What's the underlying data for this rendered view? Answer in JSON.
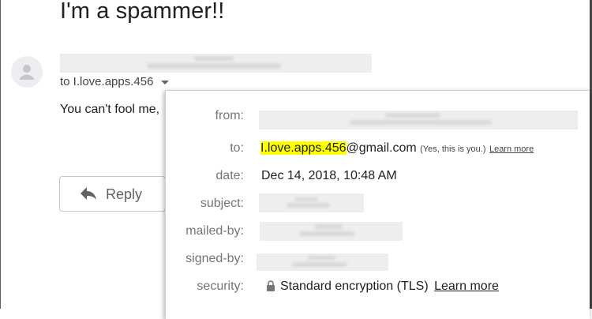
{
  "email": {
    "subject": "I'm a spammer!!",
    "to_summary": "to I.love.apps.456",
    "body_preview": "You can't fool me,",
    "reply_label": "Reply"
  },
  "details": {
    "from_label": "from:",
    "to_label": "to:",
    "to_highlight": "I.love.apps.456",
    "to_domain": "@gmail.com",
    "to_note": "(Yes, this is you.)",
    "to_learn_more": "Learn more",
    "date_label": "date:",
    "date_value": "Dec 14, 2018, 10:48 AM",
    "subject_label": "subject:",
    "mailed_by_label": "mailed-by:",
    "signed_by_label": "signed-by:",
    "security_label": "security:",
    "security_value": "Standard encryption (TLS)",
    "security_learn_more": "Learn more"
  },
  "colors": {
    "highlight": "#ffff00",
    "redaction": "#eeeeee"
  },
  "icons": [
    "avatar-person-icon",
    "dropdown-caret-icon",
    "reply-arrow-icon",
    "lock-icon"
  ]
}
